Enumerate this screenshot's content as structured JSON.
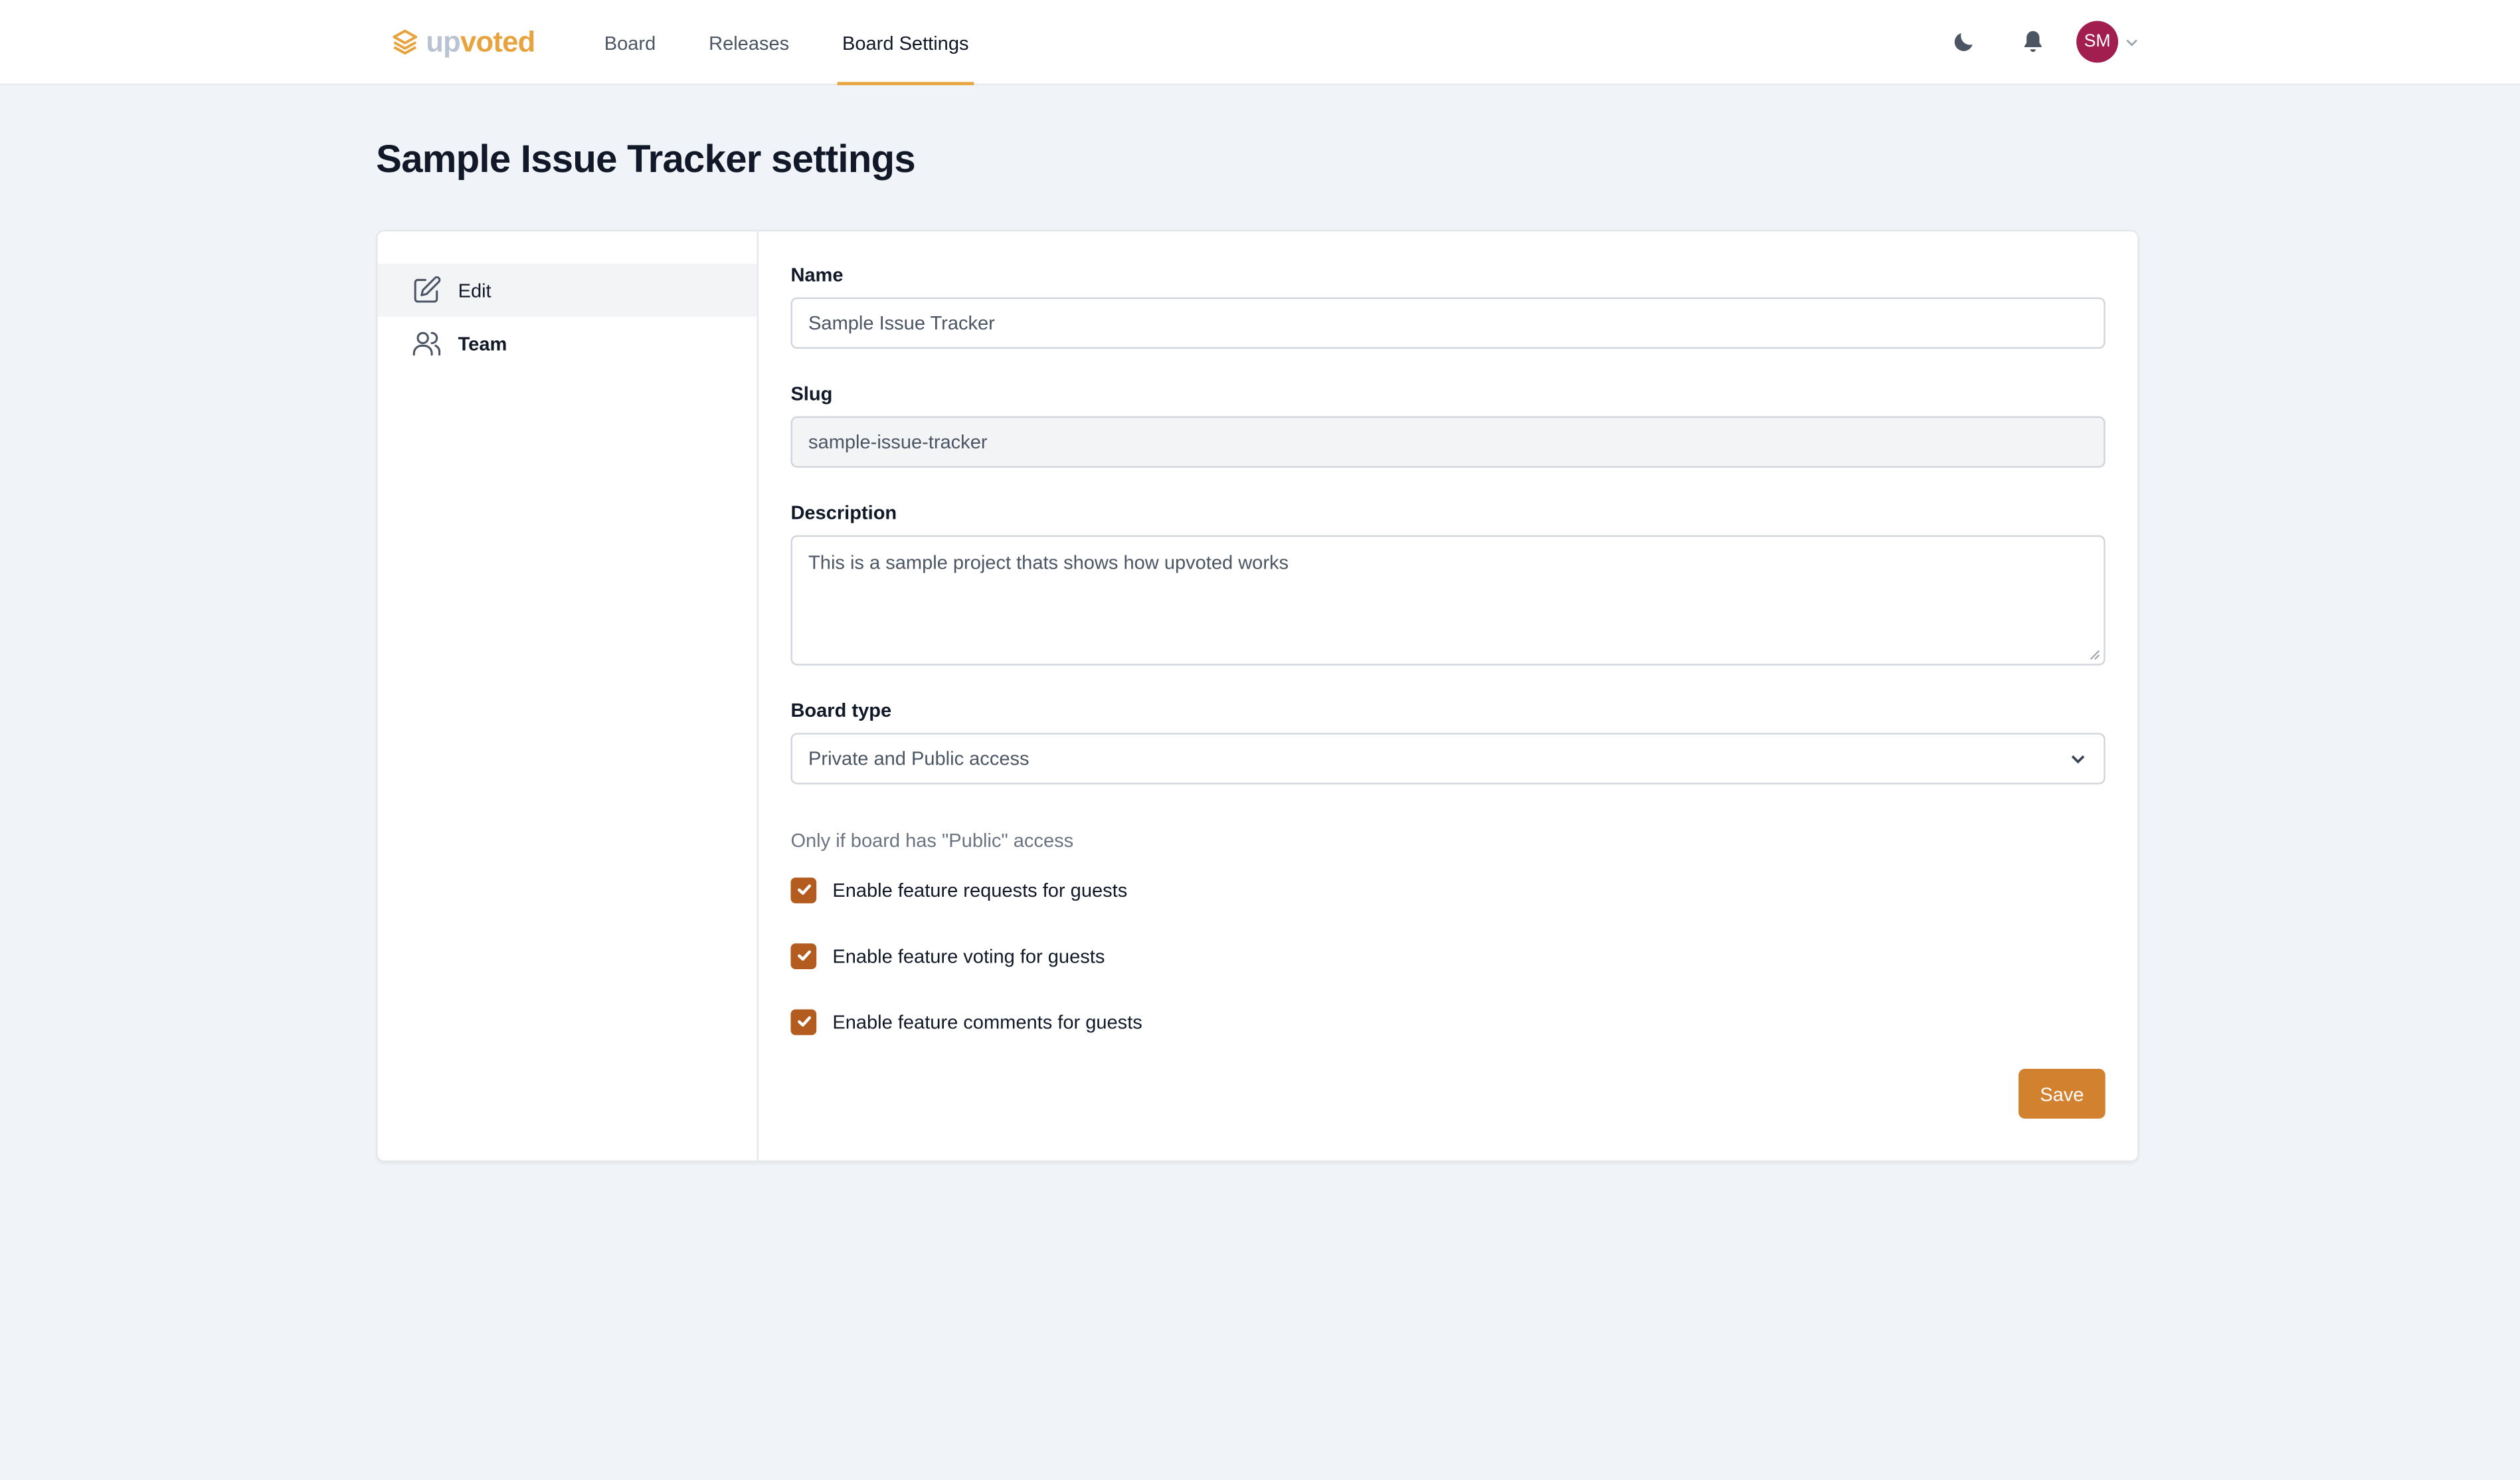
{
  "brand": {
    "name_part1": "up",
    "name_part2": "voted",
    "accent": "#e7a33e"
  },
  "nav": {
    "items": [
      {
        "label": "Board"
      },
      {
        "label": "Releases"
      },
      {
        "label": "Board Settings",
        "active": true
      }
    ]
  },
  "topbar": {
    "theme_icon": "moon-icon",
    "notifications_icon": "bell-icon",
    "avatar_initials": "SM",
    "avatar_color": "#a21e4e"
  },
  "page": {
    "title": "Sample Issue Tracker settings"
  },
  "sidebar": {
    "items": [
      {
        "label": "Edit",
        "icon": "edit-icon",
        "active": true
      },
      {
        "label": "Team",
        "icon": "users-icon"
      }
    ]
  },
  "form": {
    "name": {
      "label": "Name",
      "value": "Sample Issue Tracker"
    },
    "slug": {
      "label": "Slug",
      "value": "sample-issue-tracker"
    },
    "description": {
      "label": "Description",
      "value": "This is a sample project thats shows how upvoted works"
    },
    "board_type": {
      "label": "Board type",
      "value": "Private and Public access"
    },
    "hint": "Only if board has \"Public\" access",
    "checkboxes": [
      {
        "label": "Enable feature requests for guests",
        "checked": true
      },
      {
        "label": "Enable feature voting for guests",
        "checked": true
      },
      {
        "label": "Enable feature comments for guests",
        "checked": true
      }
    ],
    "save_label": "Save",
    "save_color": "#d2812f",
    "checkbox_color": "#b45c1f"
  }
}
